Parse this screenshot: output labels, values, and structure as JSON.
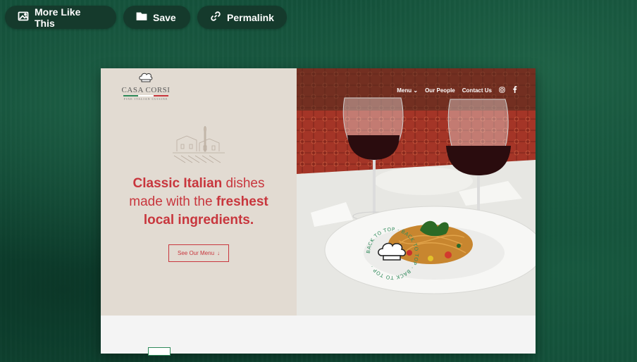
{
  "toolbar": {
    "more_like_this": "More Like This",
    "save": "Save",
    "permalink": "Permalink"
  },
  "site": {
    "logo_name": "CASA CORSI",
    "logo_tagline": "FINE ITALIAN CUISINE",
    "nav": {
      "menu": "Menu",
      "our_people": "Our People",
      "contact_us": "Contact Us"
    },
    "headline": {
      "part1": "Classic Italian",
      "part2": " dishes made with the ",
      "part3": "freshest local ingredients."
    },
    "menu_button": "See Our Menu",
    "menu_button_arrow": "↓",
    "back_to_top": "BACK TO TOP · BACK TO TOP · BACK TO TOP ·"
  },
  "colors": {
    "background": "#0f4a36",
    "pill": "#153a2c",
    "accent_red": "#c8363d",
    "panel": "#e2dbd2",
    "badge_green": "#2f8a5a"
  }
}
